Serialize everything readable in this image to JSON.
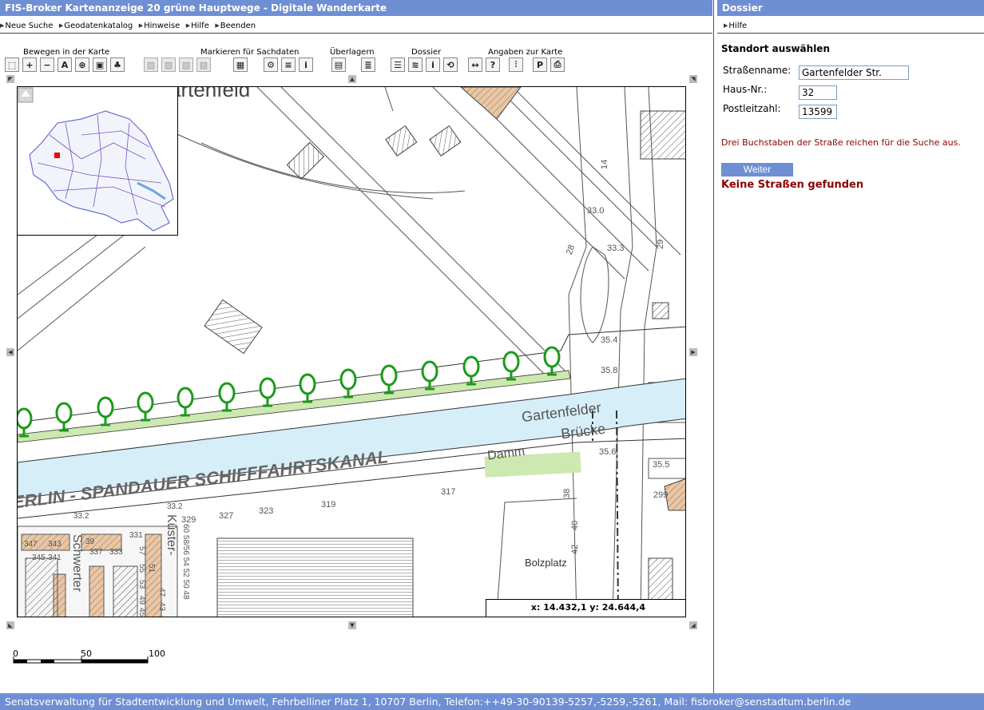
{
  "window": {
    "title": "FIS-Broker Kartenanzeige 20 grüne Hauptwege - Digitale Wanderkarte",
    "dossier_title": "Dossier"
  },
  "menu": {
    "items": [
      {
        "label": "Neue Suche"
      },
      {
        "label": "Geodatenkatalog"
      },
      {
        "label": "Hinweise"
      },
      {
        "label": "Hilfe"
      },
      {
        "label": "Beenden"
      }
    ],
    "dossier_items": [
      {
        "label": "Hilfe"
      }
    ]
  },
  "toolbar": {
    "groups": {
      "bewegen": "Bewegen in der Karte",
      "markieren": "Markieren für Sachdaten",
      "ueberlagern": "Überlagern",
      "dossier": "Dossier",
      "angaben": "Angaben zur Karte"
    },
    "buttons": [
      {
        "name": "select-rect-icon"
      },
      {
        "name": "zoom-in-icon"
      },
      {
        "name": "zoom-out-icon"
      },
      {
        "name": "pan-icon"
      },
      {
        "name": "zoom-search-icon"
      },
      {
        "name": "full-extent-icon"
      },
      {
        "name": "tree-icon"
      },
      {
        "name": "mark-point-icon"
      },
      {
        "name": "mark-line-icon"
      },
      {
        "name": "mark-polygon-icon"
      },
      {
        "name": "mark-clear-icon"
      },
      {
        "name": "mark-rect-icon"
      },
      {
        "name": "query-icon"
      },
      {
        "name": "table-icon"
      },
      {
        "name": "info-icon"
      },
      {
        "name": "layer-list-icon"
      },
      {
        "name": "layer-add-icon"
      },
      {
        "name": "dossier-list-icon"
      },
      {
        "name": "dossier-layers-icon"
      },
      {
        "name": "dossier-info-icon"
      },
      {
        "name": "dossier-search-icon"
      },
      {
        "name": "legend-icon"
      },
      {
        "name": "help-map-icon"
      },
      {
        "name": "settings-icon"
      },
      {
        "name": "pdf-icon"
      },
      {
        "name": "print-icon"
      }
    ]
  },
  "map": {
    "coords_readout": "x: 14.432,1 y: 24.644,4",
    "labels": {
      "canal": "ERLIN - SPANDAUER SCHIFFFAHRTSKANAL",
      "gartenfeld": "artenfeld",
      "gartenfelder": "Gartenfelder",
      "bruecke": "Brücke",
      "damm": "Damm",
      "bolzplatz": "Bolzplatz",
      "schwerter": "Schwerter",
      "kuester": "Küster-"
    },
    "numbers": [
      "14",
      "33.0",
      "28",
      "33.3",
      "29",
      "35.4",
      "35.8",
      "35.6",
      "35.5",
      "299",
      "317",
      "319",
      "323",
      "327",
      "329",
      "33.2",
      "33.2",
      "38",
      "40",
      "42",
      "60 58/56 54 52 50 48",
      "331",
      "337",
      "333",
      "345",
      "341",
      "343",
      "347",
      "39",
      "57",
      "55",
      "53",
      "51",
      "49",
      "47",
      "45",
      "43"
    ]
  },
  "scale": {
    "ticks": [
      "0",
      "50",
      "100"
    ]
  },
  "panel": {
    "heading": "Standort auswählen",
    "street_label": "Straßenname:",
    "street_value": "Gartenfelder Str.",
    "house_label": "Haus-Nr.:",
    "house_value": "32",
    "zip_label": "Postleitzahl:",
    "zip_value": "13599",
    "hint": "Drei Buchstaben der Straße reichen für die Suche aus.",
    "weiter": "Weiter",
    "not_found": "Keine Straßen gefunden"
  },
  "footer": "Senatsverwaltung für Stadtentwicklung und Umwelt, Fehrbelliner Platz 1, 10707 Berlin, Telefon:++49-30-90139-5257,-5259,-5261, Mail: fisbroker@senstadtum.berlin.de",
  "colors": {
    "titlebar": "#6e8fd4",
    "canal": "#d6eef8",
    "greenway": "#cde8b0",
    "tree": "#1a9a1a",
    "error": "#8b0000",
    "building_hatch": "#d9a57a"
  }
}
